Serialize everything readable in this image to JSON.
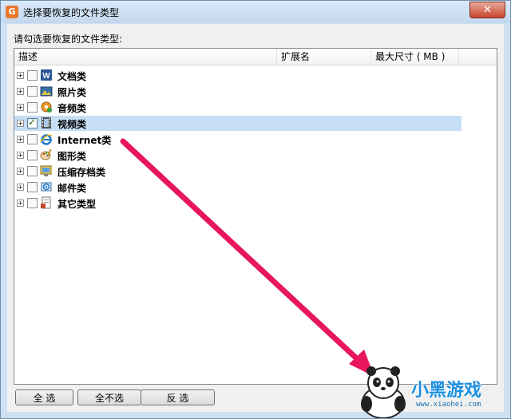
{
  "window": {
    "title": "选择要恢复的文件类型",
    "close": "✕"
  },
  "prompt": "请勾选要恢复的文件类型:",
  "columns": [
    "描述",
    "扩展名",
    "最大尺寸 ( MB )"
  ],
  "rows": [
    {
      "label": "文档类",
      "checked": false,
      "icon": "word-document-icon"
    },
    {
      "label": "照片类",
      "checked": false,
      "icon": "photo-icon"
    },
    {
      "label": "音频类",
      "checked": false,
      "icon": "audio-icon"
    },
    {
      "label": "视频类",
      "checked": true,
      "icon": "video-film-icon"
    },
    {
      "label": "Internet类",
      "checked": false,
      "icon": "internet-explorer-icon"
    },
    {
      "label": "图形类",
      "checked": false,
      "icon": "graphics-palette-icon"
    },
    {
      "label": "压缩存档类",
      "checked": false,
      "icon": "archive-icon"
    },
    {
      "label": "邮件类",
      "checked": false,
      "icon": "mail-icon"
    },
    {
      "label": "其它类型",
      "checked": false,
      "icon": "other-types-icon"
    }
  ],
  "buttons": {
    "select_all": "全 选",
    "select_none": "全不选",
    "invert": "反 选"
  },
  "watermark": {
    "brand": "小黑游戏",
    "url": "www.xiaohei.com"
  },
  "colors": {
    "selection": "#c7def7",
    "arrow": "#e8175d"
  }
}
